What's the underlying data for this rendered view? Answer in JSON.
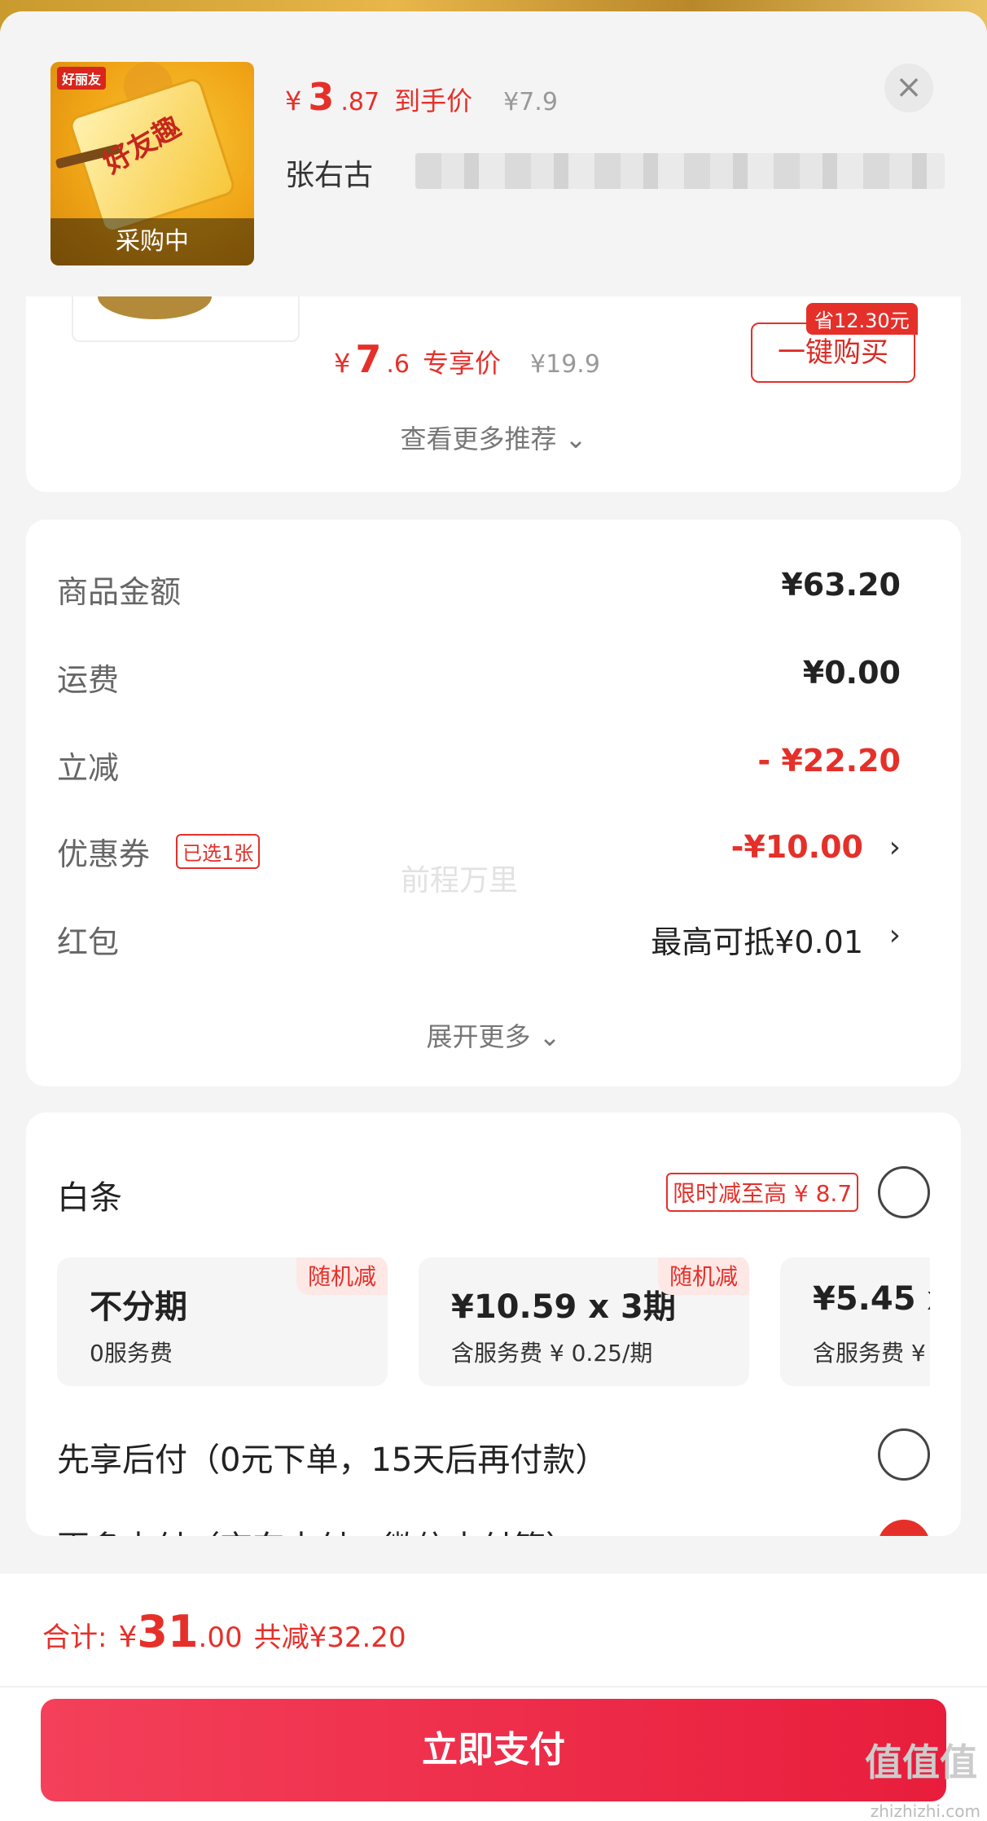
{
  "header": {
    "thumb_brand": "好丽友",
    "thumb_bag_text": "好友趣",
    "thumb_status": "采购中",
    "currency": "¥",
    "price_int": "3",
    "price_dec": ".87",
    "price_tag": "到手价",
    "orig_price": "¥7.9",
    "close_icon": "×",
    "title_visible": "张右古"
  },
  "recommend": {
    "currency": "¥",
    "price_int": "7",
    "price_dec": ".6",
    "price_tag": "专享价",
    "orig_price": "¥19.9",
    "save_tag": "省12.30元",
    "buy_label": "一键购买",
    "more_label": "查看更多推荐 ⌄"
  },
  "amounts": {
    "rows": [
      {
        "label": "商品金额",
        "value": "¥63.20"
      },
      {
        "label": "运费",
        "value": "¥0.00"
      },
      {
        "label": "立减",
        "value": "- ¥22.20"
      },
      {
        "label": "优惠券",
        "chip": "已选1张",
        "value": "-¥10.00"
      },
      {
        "label": "红包",
        "value": "最高可抵¥0.01"
      }
    ],
    "chevron": "›",
    "expand_label": "展开更多 ⌄",
    "watermark": "前程万里"
  },
  "payment": {
    "baitiao_label": "白条",
    "limit_chip": "限时减至高 ¥ 8.7",
    "plans": [
      {
        "title": "不分期",
        "sub": "0服务费",
        "badge": "随机减"
      },
      {
        "title": "¥10.59 x 3期",
        "sub": "含服务费 ¥ 0.25/期",
        "badge": "随机减"
      },
      {
        "title": "¥5.45 x",
        "sub": "含服务费 ¥",
        "badge": ""
      }
    ],
    "paylater_label": "先享后付（0元下单，15天后再付款）",
    "morepay_label": "更多支付（京东支付、微信支付等）",
    "check_icon": "✓"
  },
  "bottom": {
    "total_label": "合计:",
    "total_yen": "¥",
    "total_int": "31",
    "total_dec": ".00",
    "total_save": "共减¥32.20",
    "pay_button": "立即支付",
    "corner_mark": "值值值",
    "corner_url": "zhizhizhi.com"
  },
  "colors": {
    "accent": "#e5302a",
    "pay_button_start": "#f4405a",
    "pay_button_end": "#e81d3c",
    "background": "#f4f4f4"
  }
}
